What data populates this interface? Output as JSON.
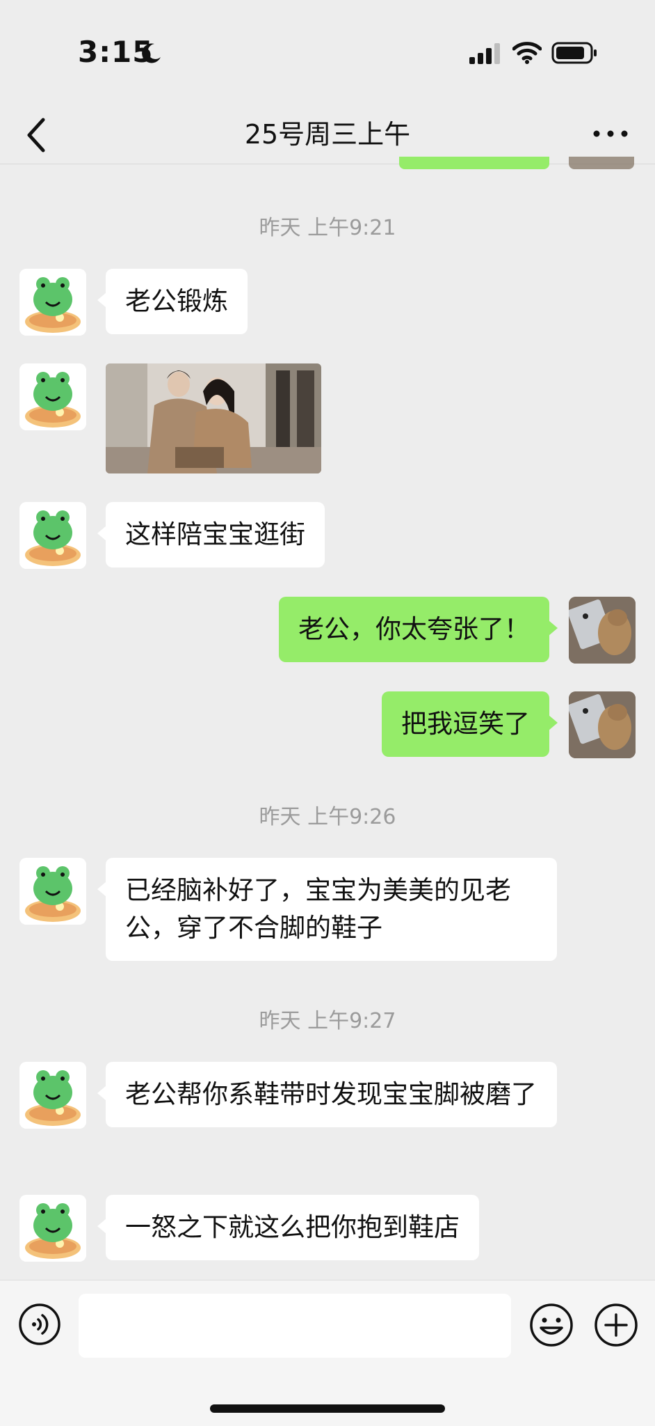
{
  "status_bar": {
    "time": "3:15"
  },
  "header": {
    "title": "25号周三上午"
  },
  "messages": [
    {
      "type": "timestamp",
      "text": "昨天 上午9:21"
    },
    {
      "type": "text",
      "side": "left",
      "text": "老公锻炼"
    },
    {
      "type": "image",
      "side": "left"
    },
    {
      "type": "text",
      "side": "left",
      "text": "这样陪宝宝逛街"
    },
    {
      "type": "text",
      "side": "right",
      "text": "老公，你太夸张了！"
    },
    {
      "type": "text",
      "side": "right",
      "text": "把我逗笑了"
    },
    {
      "type": "timestamp",
      "text": "昨天 上午9:26"
    },
    {
      "type": "text",
      "side": "left",
      "text": "已经脑补好了，宝宝为美美的见老公，穿了不合脚的鞋子"
    },
    {
      "type": "timestamp",
      "text": "昨天 上午9:27"
    },
    {
      "type": "text",
      "side": "left",
      "text": "老公帮你系鞋带时发现宝宝脚被磨了"
    },
    {
      "type": "text",
      "side": "left",
      "text": "一怒之下就这么把你抱到鞋店"
    }
  ],
  "input_bar": {
    "placeholder": ""
  },
  "colors": {
    "sent_bubble": "#95ec69",
    "received_bubble": "#ffffff",
    "background": "#ededed"
  },
  "icons": [
    "back-icon",
    "more-icon",
    "voice-icon",
    "emoji-icon",
    "plus-icon",
    "moon-icon",
    "signal-icon",
    "wifi-icon",
    "battery-icon"
  ]
}
